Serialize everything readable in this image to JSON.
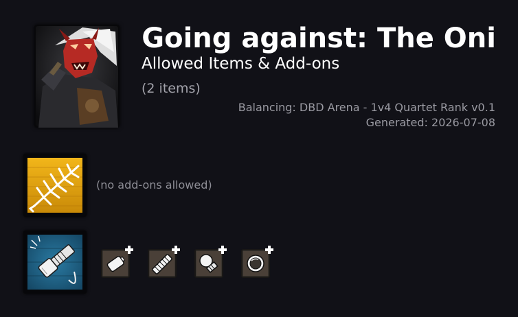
{
  "header": {
    "title": "Going against: The Oni",
    "subtitle": "Allowed Items & Add-ons",
    "item_count": "(2 items)",
    "balancing": "Balancing: DBD Arena - 1v4 Quartet Rank v0.1",
    "generated": "Generated: 2026-07-08"
  },
  "killer": {
    "name": "The Oni",
    "icon": "oni-portrait"
  },
  "items": [
    {
      "icon": "firecracker-icon",
      "tile_color": "#e3a512",
      "note": "(no add-ons allowed)"
    },
    {
      "icon": "flashlight-icon",
      "tile_color": "#1c5e80",
      "addons": [
        {
          "icon": "battery-addon-icon",
          "badge": "+"
        },
        {
          "icon": "handle-grip-addon-icon",
          "badge": "+"
        },
        {
          "icon": "bulb-addon-icon",
          "badge": "+"
        },
        {
          "icon": "lens-ring-addon-icon",
          "badge": "+"
        }
      ]
    }
  ]
}
